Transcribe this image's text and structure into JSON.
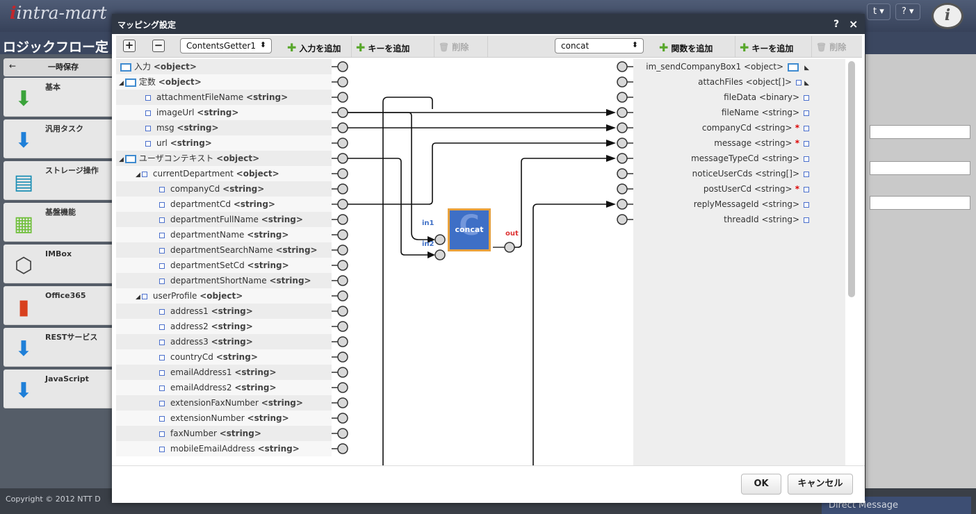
{
  "app": {
    "logo": "intra-mart",
    "logo_initial": "i",
    "page_title": "ロジックフロー定",
    "top_buttons": [
      "t ▾",
      "? ▾"
    ],
    "circle_logo": "i",
    "copyright": "Copyright © 2012 NTT D",
    "direct_message": "Direct Message"
  },
  "left_panel": {
    "toolbar": {
      "back_icon": "←",
      "temp_save": "一時保存"
    },
    "items": [
      {
        "label": "基本",
        "icon": "arrow-down-green-icon",
        "glyph": "⬇"
      },
      {
        "label": "汎用タスク",
        "icon": "arrow-down-blue-icon",
        "glyph": "⬇"
      },
      {
        "label": "ストレージ操作",
        "icon": "storage-icon",
        "glyph": "▤"
      },
      {
        "label": "基盤機能",
        "icon": "grid-icon",
        "glyph": "▦"
      },
      {
        "label": "IMBox",
        "icon": "box-icon",
        "glyph": "⬡"
      },
      {
        "label": "Office365",
        "icon": "office-icon",
        "glyph": "▮"
      },
      {
        "label": "RESTサービス",
        "icon": "arrow-down-blue-icon",
        "glyph": "⬇"
      },
      {
        "label": "JavaScript",
        "icon": "arrow-down-blue-icon",
        "glyph": "⬇"
      }
    ]
  },
  "dialog": {
    "title": "マッピング設定",
    "help": "?",
    "close": "×",
    "toolbar": {
      "source_select": "ContentsGetter1",
      "add_input": "入力を追加",
      "add_key": "キーを追加",
      "delete": "削除",
      "function_select": "concat",
      "add_function": "関数を追加",
      "add_key_right": "キーを追加",
      "delete_right": "削除"
    },
    "ok": "OK",
    "cancel": "キャンセル"
  },
  "left_tree": [
    {
      "name": "入力",
      "type": "<object>",
      "level": 0,
      "kind": "root",
      "expanded": false
    },
    {
      "name": "定数",
      "type": "<object>",
      "level": 0,
      "kind": "root",
      "expanded": true
    },
    {
      "name": "attachmentFileName",
      "type": "<string>",
      "level": 1,
      "kind": "leaf"
    },
    {
      "name": "imageUrl",
      "type": "<string>",
      "level": 1,
      "kind": "leaf"
    },
    {
      "name": "msg",
      "type": "<string>",
      "level": 1,
      "kind": "leaf"
    },
    {
      "name": "url",
      "type": "<string>",
      "level": 1,
      "kind": "leaf"
    },
    {
      "name": "ユーザコンテキスト",
      "type": "<object>",
      "level": 0,
      "kind": "root",
      "expanded": true
    },
    {
      "name": "currentDepartment",
      "type": "<object>",
      "level": 1,
      "kind": "branch"
    },
    {
      "name": "companyCd",
      "type": "<string>",
      "level": 2,
      "kind": "leaf"
    },
    {
      "name": "departmentCd",
      "type": "<string>",
      "level": 2,
      "kind": "leaf"
    },
    {
      "name": "departmentFullName",
      "type": "<string>",
      "level": 2,
      "kind": "leaf"
    },
    {
      "name": "departmentName",
      "type": "<string>",
      "level": 2,
      "kind": "leaf"
    },
    {
      "name": "departmentSearchName",
      "type": "<string>",
      "level": 2,
      "kind": "leaf"
    },
    {
      "name": "departmentSetCd",
      "type": "<string>",
      "level": 2,
      "kind": "leaf"
    },
    {
      "name": "departmentShortName",
      "type": "<string>",
      "level": 2,
      "kind": "leaf"
    },
    {
      "name": "userProfile",
      "type": "<object>",
      "level": 1,
      "kind": "branch"
    },
    {
      "name": "address1",
      "type": "<string>",
      "level": 2,
      "kind": "leaf"
    },
    {
      "name": "address2",
      "type": "<string>",
      "level": 2,
      "kind": "leaf"
    },
    {
      "name": "address3",
      "type": "<string>",
      "level": 2,
      "kind": "leaf"
    },
    {
      "name": "countryCd",
      "type": "<string>",
      "level": 2,
      "kind": "leaf"
    },
    {
      "name": "emailAddress1",
      "type": "<string>",
      "level": 2,
      "kind": "leaf"
    },
    {
      "name": "emailAddress2",
      "type": "<string>",
      "level": 2,
      "kind": "leaf"
    },
    {
      "name": "extensionFaxNumber",
      "type": "<string>",
      "level": 2,
      "kind": "leaf"
    },
    {
      "name": "extensionNumber",
      "type": "<string>",
      "level": 2,
      "kind": "leaf"
    },
    {
      "name": "faxNumber",
      "type": "<string>",
      "level": 2,
      "kind": "leaf"
    },
    {
      "name": "mobileEmailAddress",
      "type": "<string>",
      "level": 2,
      "kind": "leaf"
    }
  ],
  "right_tree": [
    {
      "name": "im_sendCompanyBox1",
      "type": "<object>",
      "required": false,
      "root": true
    },
    {
      "name": "attachFiles",
      "type": "<object[]>",
      "required": false,
      "arrow": true
    },
    {
      "name": "fileData",
      "type": "<binary>",
      "required": false
    },
    {
      "name": "fileName",
      "type": "<string>",
      "required": false
    },
    {
      "name": "companyCd",
      "type": "<string>",
      "required": true
    },
    {
      "name": "message",
      "type": "<string>",
      "required": true
    },
    {
      "name": "messageTypeCd",
      "type": "<string>",
      "required": false
    },
    {
      "name": "noticeUserCds",
      "type": "<string[]>",
      "required": false
    },
    {
      "name": "postUserCd",
      "type": "<string>",
      "required": true
    },
    {
      "name": "replyMessageId",
      "type": "<string>",
      "required": false
    },
    {
      "name": "threadId",
      "type": "<string>",
      "required": false
    }
  ],
  "function_block": {
    "label": "concat",
    "in1": "in1",
    "in2": "in2",
    "out": "out"
  }
}
